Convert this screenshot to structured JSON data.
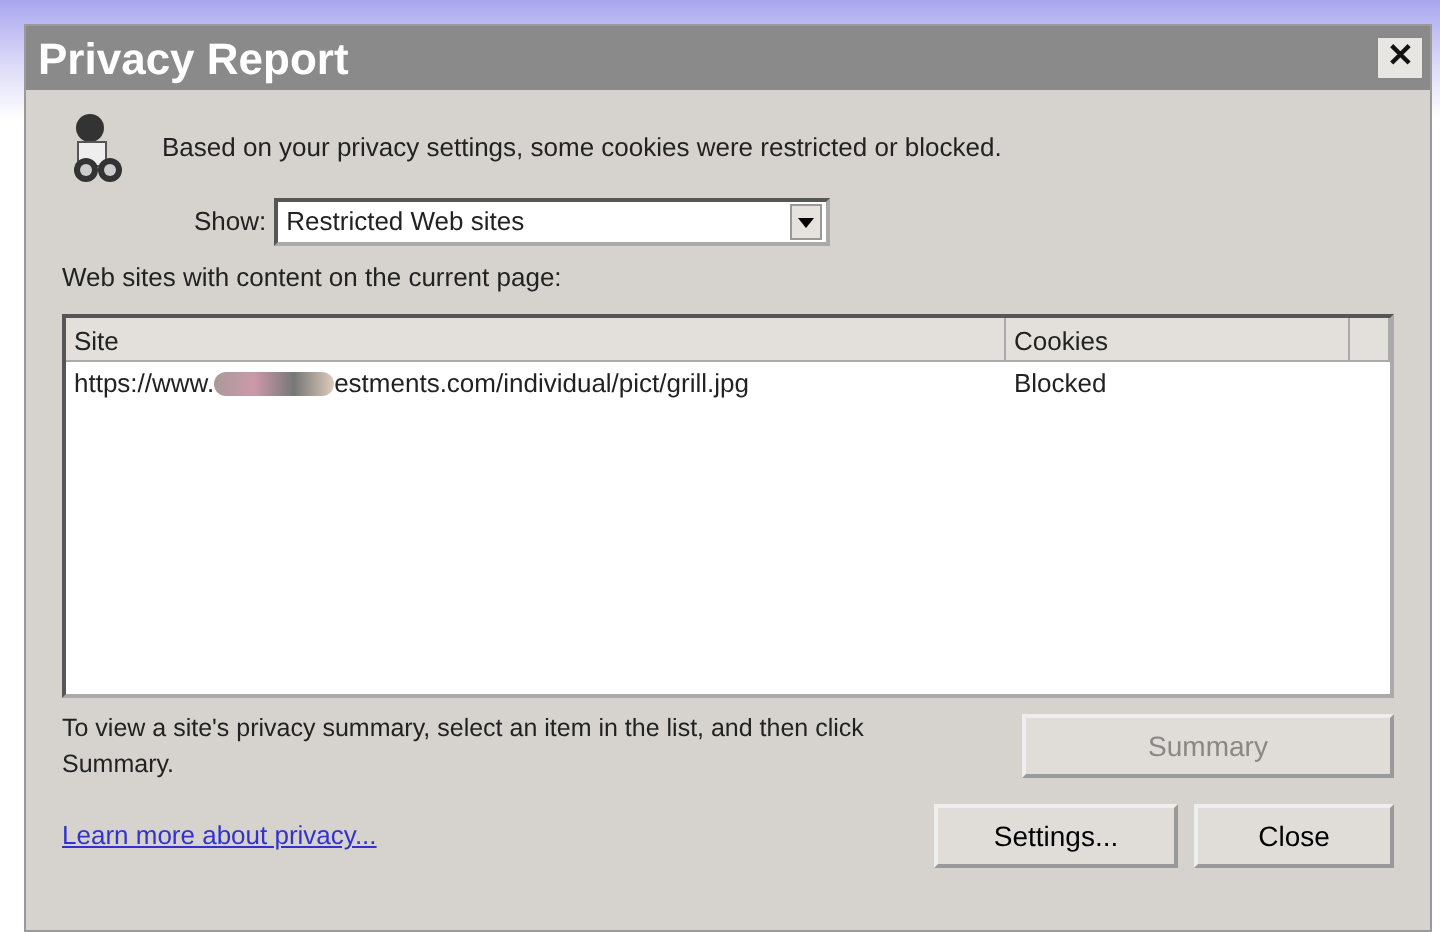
{
  "window": {
    "title": "Privacy Report",
    "close": "✕"
  },
  "message": "Based on your privacy settings, some cookies were restricted or blocked.",
  "show": {
    "label": "Show:",
    "value": "Restricted Web sites"
  },
  "list_caption": "Web sites with content on the current page:",
  "table": {
    "columns": [
      "Site",
      "Cookies"
    ],
    "rows": [
      {
        "site_start": "https://www.",
        "site_end": "estments.com/individual/pict/grill.jpg",
        "cookies": "Blocked",
        "selected": false
      }
    ]
  },
  "hint": "To view a site's privacy summary, select an item in the list, and then click Summary.",
  "buttons": [
    {
      "label": "Summary",
      "disabled": true
    },
    {
      "label": "Settings...",
      "disabled": false
    },
    {
      "label": "Close",
      "disabled": false
    }
  ],
  "link": "Learn more about privacy..."
}
